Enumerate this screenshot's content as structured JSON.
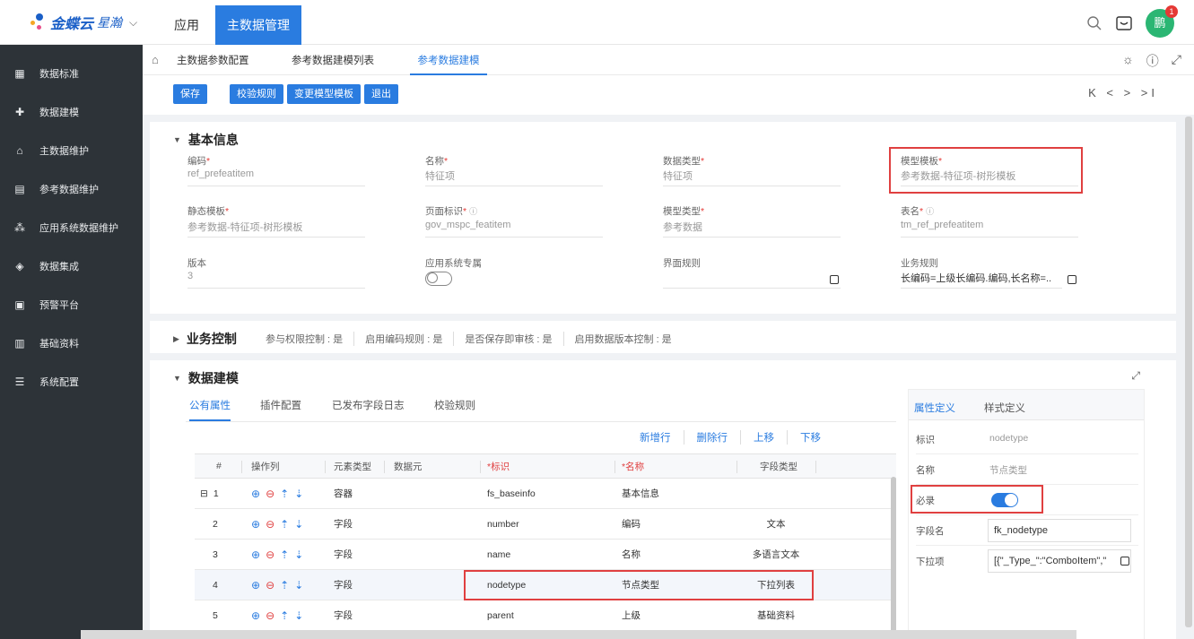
{
  "header": {
    "logo_text": "金蝶云",
    "logo_sub": "星瀚",
    "nav_app": "应用",
    "nav_masterdata": "主数据管理",
    "avatar_text": "鹏",
    "badge_count": "1"
  },
  "sidebar": {
    "items": [
      {
        "label": "数据标准",
        "icon": "chart-icon"
      },
      {
        "label": "数据建模",
        "icon": "puzzle-icon"
      },
      {
        "label": "主数据维护",
        "icon": "bank-icon"
      },
      {
        "label": "参考数据维护",
        "icon": "table-icon"
      },
      {
        "label": "应用系统数据维护",
        "icon": "nodes-icon"
      },
      {
        "label": "数据集成",
        "icon": "cube-icon"
      },
      {
        "label": "预警平台",
        "icon": "monitor-icon"
      },
      {
        "label": "基础资料",
        "icon": "clipboard-icon"
      },
      {
        "label": "系统配置",
        "icon": "settings-icon"
      }
    ]
  },
  "tabs": {
    "items": [
      "主数据参数配置",
      "参考数据建模列表",
      "参考数据建模"
    ]
  },
  "toolbar": {
    "save": "保存",
    "validate": "校验规则",
    "change_template": "变更模型模板",
    "exit": "退出",
    "pager": "K < > >I"
  },
  "basic": {
    "title": "基本信息",
    "fields": [
      {
        "label": "编码",
        "value": "ref_prefeatitem",
        "required": "*"
      },
      {
        "label": "名称",
        "value": "特征项",
        "required": "*"
      },
      {
        "label": "数据类型",
        "value": "特征项",
        "required": "*"
      },
      {
        "label": "模型模板",
        "value": "参考数据-特征项-树形模板",
        "required": "*"
      },
      {
        "label": "静态模板",
        "value": "参考数据-特征项-树形模板",
        "required": "*"
      },
      {
        "label": "页面标识",
        "value": "gov_mspc_featitem",
        "required": "*"
      },
      {
        "label": "模型类型",
        "value": "参考数据",
        "required": "*"
      },
      {
        "label": "表名",
        "value": "tm_ref_prefeatitem",
        "required": "*"
      },
      {
        "label": "版本",
        "value": "3",
        "required": ""
      },
      {
        "label": "应用系统专属",
        "value": "",
        "required": ""
      },
      {
        "label": "界面规则",
        "value": "",
        "required": ""
      },
      {
        "label": "业务规则",
        "value": "长编码=上级长编码.编码,长名称=..",
        "required": ""
      }
    ]
  },
  "business": {
    "title": "业务控制",
    "items": [
      "参与权限控制 : 是",
      "启用编码规则 : 是",
      "是否保存即审核 : 是",
      "启用数据版本控制 : 是"
    ]
  },
  "modeling": {
    "title": "数据建模",
    "subtabs": [
      "公有属性",
      "插件配置",
      "已发布字段日志",
      "校验规则"
    ],
    "actions": [
      "新增行",
      "删除行",
      "上移",
      "下移"
    ],
    "columns": [
      "#",
      "操作列",
      "元素类型",
      "数据元",
      "*标识",
      "*名称",
      "字段类型"
    ],
    "rows": [
      {
        "no": "1",
        "type": "容器",
        "element": "",
        "id": "fs_baseinfo",
        "name": "基本信息",
        "ftype": ""
      },
      {
        "no": "2",
        "type": "字段",
        "element": "",
        "id": "number",
        "name": "编码",
        "ftype": "文本"
      },
      {
        "no": "3",
        "type": "字段",
        "element": "",
        "id": "name",
        "name": "名称",
        "ftype": "多语言文本"
      },
      {
        "no": "4",
        "type": "字段",
        "element": "",
        "id": "nodetype",
        "name": "节点类型",
        "ftype": "下拉列表"
      },
      {
        "no": "5",
        "type": "字段",
        "element": "",
        "id": "parent",
        "name": "上级",
        "ftype": "基础资料"
      }
    ],
    "expand_mark": "⊟"
  },
  "property_panel": {
    "tabs": [
      "属性定义",
      "样式定义"
    ],
    "rows": [
      {
        "key": "标识",
        "value": "nodetype"
      },
      {
        "key": "名称",
        "value": "节点类型"
      },
      {
        "key": "必录",
        "value": ""
      },
      {
        "key": "字段名",
        "value": "fk_nodetype"
      },
      {
        "key": "下拉项",
        "value": "[{\"_Type_\":\"ComboItem\",\""
      }
    ]
  },
  "colors": {
    "primary": "#2a7ce0",
    "sidebar_bg": "#2d3338",
    "highlight_border": "#e04040"
  }
}
